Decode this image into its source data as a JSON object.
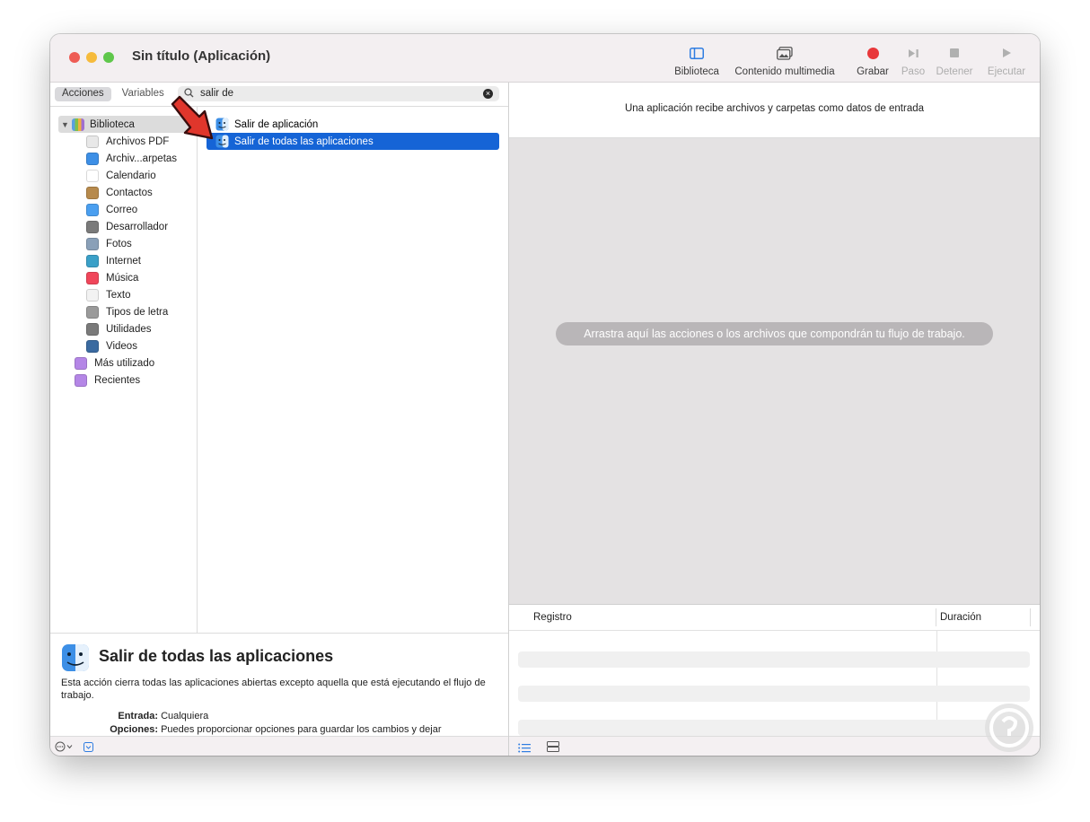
{
  "window": {
    "title": "Sin título (Aplicación)"
  },
  "toolbar": {
    "library_label": "Biblioteca",
    "media_label": "Contenido multimedia",
    "record_label": "Grabar",
    "step_label": "Paso",
    "stop_label": "Detener",
    "run_label": "Ejecutar"
  },
  "sidebar": {
    "tab_actions": "Acciones",
    "tab_variables": "Variables",
    "search_value": "salir de",
    "root_label": "Biblioteca",
    "items": [
      {
        "label": "Archivos PDF",
        "icon": "pdf-icon",
        "color": "#e8e8e8"
      },
      {
        "label": "Archiv...arpetas",
        "icon": "finder-icon",
        "color": "#3d8fe6"
      },
      {
        "label": "Calendario",
        "icon": "calendar-icon",
        "color": "#ffffff"
      },
      {
        "label": "Contactos",
        "icon": "contacts-icon",
        "color": "#b78a4c"
      },
      {
        "label": "Correo",
        "icon": "mail-icon",
        "color": "#4a9ff0"
      },
      {
        "label": "Desarrollador",
        "icon": "developer-tools-icon",
        "color": "#7a7a7a"
      },
      {
        "label": "Fotos",
        "icon": "photos-icon",
        "color": "#8aa0b8"
      },
      {
        "label": "Internet",
        "icon": "globe-icon",
        "color": "#3aa0c8"
      },
      {
        "label": "Música",
        "icon": "music-icon",
        "color": "#f0465a"
      },
      {
        "label": "Texto",
        "icon": "text-icon",
        "color": "#f2f2f2"
      },
      {
        "label": "Tipos de letra",
        "icon": "fonts-icon",
        "color": "#9a9a9a"
      },
      {
        "label": "Utilidades",
        "icon": "utilities-icon",
        "color": "#7a7a7a"
      },
      {
        "label": "Videos",
        "icon": "video-icon",
        "color": "#3a6aa0"
      }
    ],
    "extra_items": [
      {
        "label": "Más utilizado",
        "icon": "smart-folder-icon",
        "color": "#b486e6"
      },
      {
        "label": "Recientes",
        "icon": "smart-folder-icon",
        "color": "#b486e6"
      }
    ]
  },
  "results": [
    {
      "label": "Salir de aplicación",
      "selected": false
    },
    {
      "label": "Salir de todas las aplicaciones",
      "selected": true
    }
  ],
  "description": {
    "title": "Salir de todas las aplicaciones",
    "body": "Esta acción cierra todas las aplicaciones abiertas excepto aquella que está ejecutando el flujo de trabajo.",
    "input_label": "Entrada:",
    "input_value": "Cualquiera",
    "options_label": "Opciones:",
    "options_value": "Puedes proporcionar opciones para guardar los cambios y dejar"
  },
  "workflow": {
    "header": "Una aplicación recibe archivos y carpetas como datos de entrada",
    "placeholder": "Arrastra aquí las acciones o los archivos que compondrán tu flujo de trabajo."
  },
  "log": {
    "col_log": "Registro",
    "col_duration": "Duración"
  },
  "colors": {
    "accent": "#1564d6",
    "record": "#e8373a"
  }
}
